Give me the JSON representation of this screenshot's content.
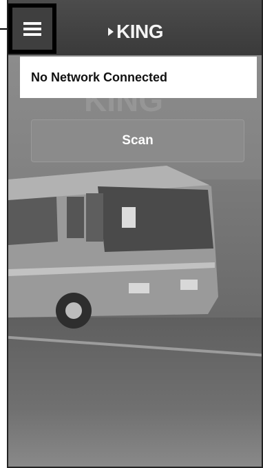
{
  "header": {
    "brand": "KING",
    "menu_icon": "hamburger-icon"
  },
  "status": {
    "message": "No Network Connected"
  },
  "actions": {
    "scan_label": "Scan"
  },
  "background": {
    "faded_brand": "KING",
    "image": "rv-on-road"
  },
  "colors": {
    "header_bg": "#404040",
    "card_bg": "#ffffff",
    "button_bg": "#8b8b8b"
  }
}
